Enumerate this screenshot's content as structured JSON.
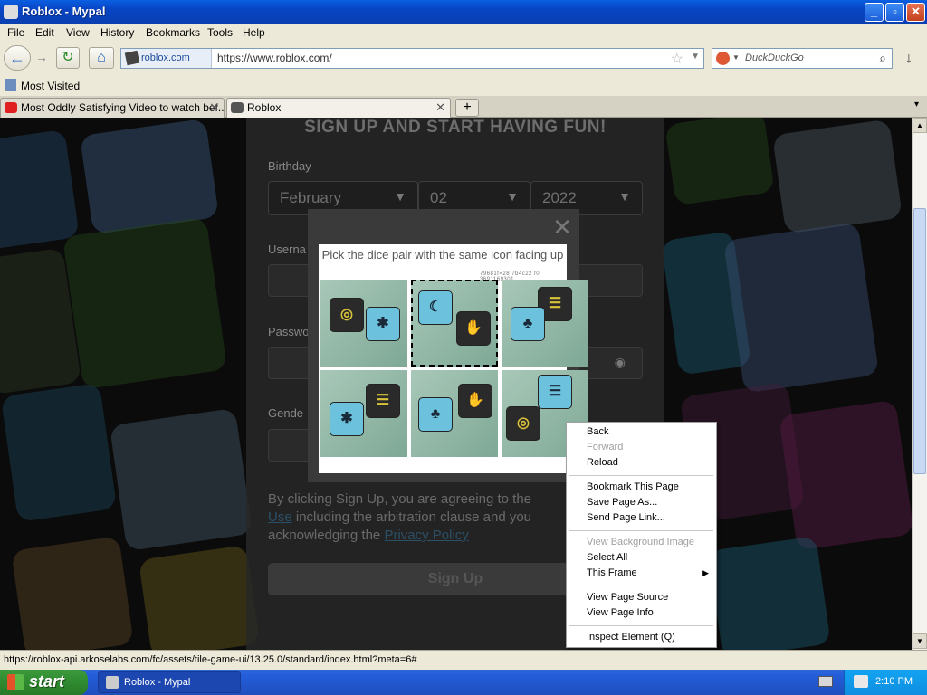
{
  "window": {
    "title": "Roblox - Mypal",
    "minimize_label": "_",
    "maximize_label": "▫",
    "close_label": "✕"
  },
  "menu": [
    "File",
    "Edit",
    "View",
    "History",
    "Bookmarks",
    "Tools",
    "Help"
  ],
  "nav": {
    "back_glyph": "←",
    "forward_glyph": "→",
    "reload_glyph": "↻",
    "home_glyph": "⌂",
    "identity": "roblox.com",
    "url": "https://www.roblox.com/",
    "search_placeholder": "DuckDuckGo",
    "download_glyph": "↓"
  },
  "bookmarks": {
    "most_visited": "Most Visited"
  },
  "tabs": [
    {
      "label": "Most Oddly Satisfying Video to watch bef...",
      "close": "✕"
    },
    {
      "label": "Roblox",
      "close": "✕"
    }
  ],
  "new_tab": "+",
  "page": {
    "heading": "SIGN UP AND START HAVING FUN!",
    "birthday_label": "Birthday",
    "month": "February",
    "day": "02",
    "year": "2022",
    "username_label": "Userna",
    "password_label": "Passwo",
    "gender_label": "Gende",
    "agree_text_1": "By clicking Sign Up, you are agreeing to the ",
    "terms_link": "Use",
    "agree_text_2": " including the arbitration clause and you",
    "agree_text_3": "acknowledging the ",
    "privacy_link": "Privacy Policy",
    "signup_button": "Sign Up"
  },
  "captcha": {
    "prompt": "Pick the dice pair with the same icon facing up",
    "code": "79681f=28 7b4c22 f0  3691169301",
    "close": "✕"
  },
  "context_menu": {
    "items": [
      {
        "label": "Back",
        "disabled": false
      },
      {
        "label": "Forward",
        "disabled": true
      },
      {
        "label": "Reload",
        "disabled": false
      },
      {
        "label": "Bookmark This Page",
        "disabled": false
      },
      {
        "label": "Save Page As...",
        "disabled": false
      },
      {
        "label": "Send Page Link...",
        "disabled": false
      },
      {
        "label": "View Background Image",
        "disabled": true
      },
      {
        "label": "Select All",
        "disabled": false
      },
      {
        "label": "This Frame",
        "disabled": false
      },
      {
        "label": "View Page Source",
        "disabled": false
      },
      {
        "label": "View Page Info",
        "disabled": false
      },
      {
        "label": "Inspect Element (Q)",
        "disabled": false
      }
    ]
  },
  "status": "https://roblox-api.arkoselabs.com/fc/assets/tile-game-ui/13.25.0/standard/index.html?meta=6#",
  "taskbar": {
    "start": "start",
    "window_item": "Roblox - Mypal",
    "clock": "2:10 PM"
  }
}
